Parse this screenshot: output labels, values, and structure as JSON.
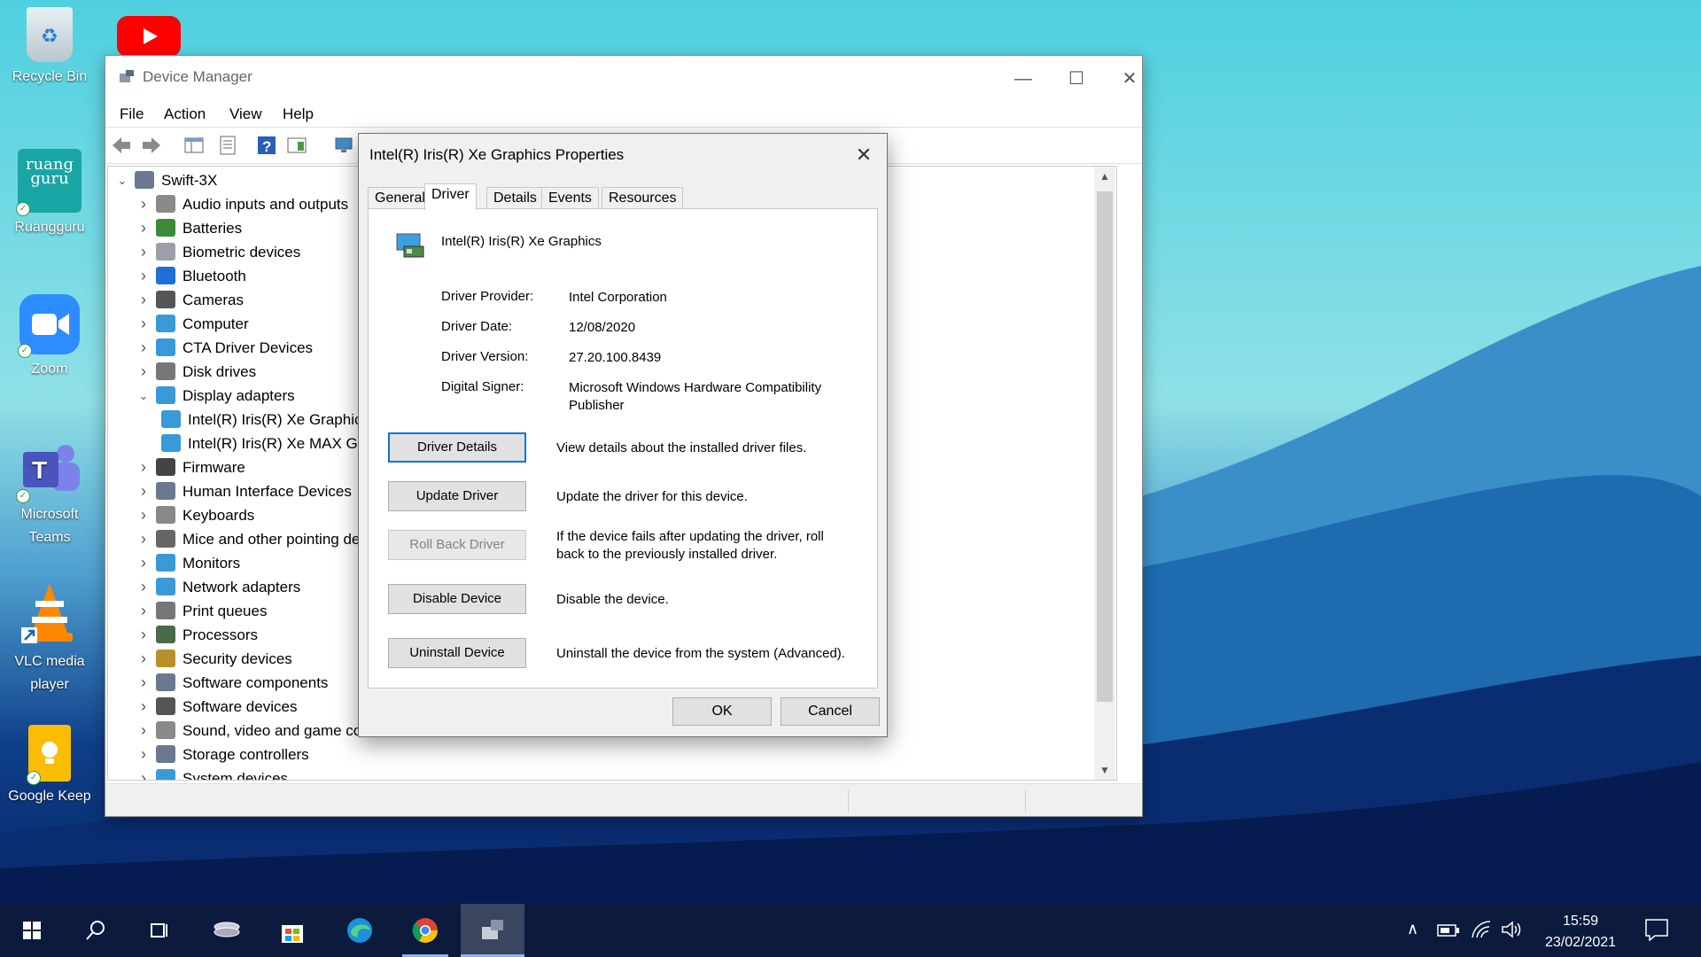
{
  "desktop": {
    "icons": [
      {
        "label": "Recycle Bin"
      },
      {
        "label": ""
      },
      {
        "label": "Ruangguru"
      },
      {
        "label": "Zoom"
      },
      {
        "label": "Microsoft Teams"
      },
      {
        "label": "VLC media player"
      },
      {
        "label": "Google Keep"
      }
    ],
    "ruangguru_logo_text": "ruang guru"
  },
  "device_manager": {
    "title": "Device Manager",
    "menu": [
      "File",
      "Action",
      "View",
      "Help"
    ],
    "tree": [
      {
        "label": "Swift-3X",
        "expanded": true,
        "level": 0,
        "icon": "computer-icon"
      },
      {
        "label": "Audio inputs and outputs",
        "level": 1,
        "icon": "speaker-icon"
      },
      {
        "label": "Batteries",
        "level": 1,
        "icon": "battery-icon"
      },
      {
        "label": "Biometric devices",
        "level": 1,
        "icon": "fingerprint-icon"
      },
      {
        "label": "Bluetooth",
        "level": 1,
        "icon": "bluetooth-icon"
      },
      {
        "label": "Cameras",
        "level": 1,
        "icon": "camera-icon"
      },
      {
        "label": "Computer",
        "level": 1,
        "icon": "monitor-icon"
      },
      {
        "label": "CTA Driver Devices",
        "level": 1,
        "icon": "monitor-icon"
      },
      {
        "label": "Disk drives",
        "level": 1,
        "icon": "disk-icon"
      },
      {
        "label": "Display adapters",
        "level": 1,
        "expanded": true,
        "icon": "display-adapter-icon"
      },
      {
        "label": "Intel(R) Iris(R) Xe Graphics",
        "level": 2,
        "icon": "display-adapter-icon"
      },
      {
        "label": "Intel(R) Iris(R) Xe MAX Graphics",
        "level": 2,
        "icon": "display-adapter-icon"
      },
      {
        "label": "Firmware",
        "level": 1,
        "icon": "chip-icon"
      },
      {
        "label": "Human Interface Devices",
        "level": 1,
        "icon": "hid-icon"
      },
      {
        "label": "Keyboards",
        "level": 1,
        "icon": "keyboard-icon"
      },
      {
        "label": "Mice and other pointing devices",
        "level": 1,
        "icon": "mouse-icon"
      },
      {
        "label": "Monitors",
        "level": 1,
        "icon": "monitor-icon"
      },
      {
        "label": "Network adapters",
        "level": 1,
        "icon": "network-icon"
      },
      {
        "label": "Print queues",
        "level": 1,
        "icon": "printer-icon"
      },
      {
        "label": "Processors",
        "level": 1,
        "icon": "processor-icon"
      },
      {
        "label": "Security devices",
        "level": 1,
        "icon": "security-icon"
      },
      {
        "label": "Software components",
        "level": 1,
        "icon": "component-icon"
      },
      {
        "label": "Software devices",
        "level": 1,
        "icon": "software-device-icon"
      },
      {
        "label": "Sound, video and game controllers",
        "level": 1,
        "icon": "speaker-icon"
      },
      {
        "label": "Storage controllers",
        "level": 1,
        "icon": "storage-icon"
      },
      {
        "label": "System devices",
        "level": 1,
        "icon": "system-icon"
      }
    ]
  },
  "dialog": {
    "title": "Intel(R) Iris(R) Xe Graphics Properties",
    "tabs": [
      "General",
      "Driver",
      "Details",
      "Events",
      "Resources"
    ],
    "active_tab": "Driver",
    "device_name": "Intel(R) Iris(R) Xe Graphics",
    "properties": [
      {
        "label": "Driver Provider:",
        "value": "Intel Corporation"
      },
      {
        "label": "Driver Date:",
        "value": "12/08/2020"
      },
      {
        "label": "Driver Version:",
        "value": "27.20.100.8439"
      },
      {
        "label": "Digital Signer:",
        "value": "Microsoft Windows Hardware Compatibility Publisher"
      }
    ],
    "actions": [
      {
        "label": "Driver Details",
        "description": "View details about the installed driver files.",
        "enabled": true,
        "focused": true
      },
      {
        "label": "Update Driver",
        "description": "Update the driver for this device.",
        "enabled": true
      },
      {
        "label": "Roll Back Driver",
        "description": "If the device fails after updating the driver, roll back to the previously installed driver.",
        "enabled": false
      },
      {
        "label": "Disable Device",
        "description": "Disable the device.",
        "enabled": true
      },
      {
        "label": "Uninstall Device",
        "description": "Uninstall the device from the system (Advanced).",
        "enabled": true
      }
    ],
    "ok_label": "OK",
    "cancel_label": "Cancel"
  },
  "taskbar": {
    "time": "15:59",
    "date": "23/02/2021",
    "apps": [
      "start-icon",
      "search-icon",
      "task-view-icon",
      "network-drive-icon",
      "store-icon",
      "edge-icon",
      "chrome-icon",
      "device-manager-icon"
    ]
  },
  "colors": {
    "accent": "#0078d7",
    "taskbar": "#0b1a3d"
  }
}
